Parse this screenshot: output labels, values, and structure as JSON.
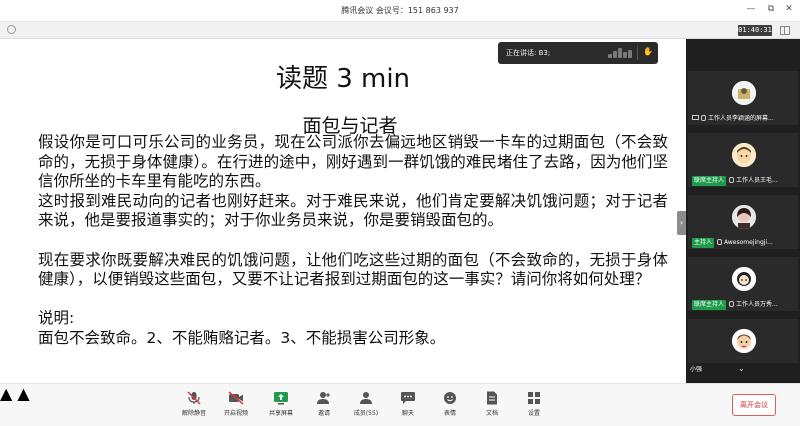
{
  "window": {
    "title": "腾讯会议  会议号：151 863 937",
    "controls": [
      "—",
      "⧉",
      "✕"
    ]
  },
  "topbar": {
    "timer": "01:40:31"
  },
  "speaking": {
    "label": "正在讲话: B3;"
  },
  "slide": {
    "heading": "读题 3 min",
    "subheading": "面包与记者",
    "paragraphs": [
      "假设你是可口可乐公司的业务员，现在公司派你去偏远地区销毁一卡车的过期面包（不会致命的，无损于身体健康）。在行进的途中，刚好遇到一群饥饿的难民堵住了去路，因为他们坚信你所坐的卡车里有能吃的东西。",
      "这时报到难民动向的记者也刚好赶来。对于难民来说，他们肯定要解决饥饿问题；对于记者来说，他是要报道事实的；对于你业务员来说，你是要销毁面包的。",
      "现在要求你既要解决难民的饥饿问题，让他们吃这些过期的面包（不会致命的，无损于身体健康），以便销毁这些面包，又要不让记者报到过期面包的这一事实？请问你将如何处理？",
      "说明:",
      "面包不会致命。2、不能贿赂记者。3、不能损害公司形象。"
    ]
  },
  "gallery": {
    "participants": [
      {
        "role": "",
        "name": "工作人员李颖涵的屏幕..."
      },
      {
        "role": "联席主持人",
        "name": "工作人员王毛..."
      },
      {
        "role": "主持人",
        "name": "Awesomejingji..."
      },
      {
        "role": "联席主持人",
        "name": "工作人员万秀..."
      },
      {
        "role": "",
        "name": "小强"
      }
    ]
  },
  "toolbar": {
    "items": [
      {
        "label": "解除静音",
        "icon": "microphone-muted-icon"
      },
      {
        "label": "开启视频",
        "icon": "video-off-icon"
      },
      {
        "label": "共享屏幕",
        "icon": "share-screen-icon"
      },
      {
        "label": "邀请",
        "icon": "invite-icon"
      },
      {
        "label": "成员(55)",
        "icon": "members-icon"
      },
      {
        "label": "聊天",
        "icon": "chat-icon"
      },
      {
        "label": "表情",
        "icon": "emoji-icon"
      },
      {
        "label": "文档",
        "icon": "document-icon"
      },
      {
        "label": "设置",
        "icon": "settings-icon"
      }
    ],
    "leave_label": "离开会议"
  },
  "colors": {
    "accent_green": "#1e9c4c",
    "leave_red": "#d9353a",
    "gallery_bg": "#1f1f1f"
  }
}
